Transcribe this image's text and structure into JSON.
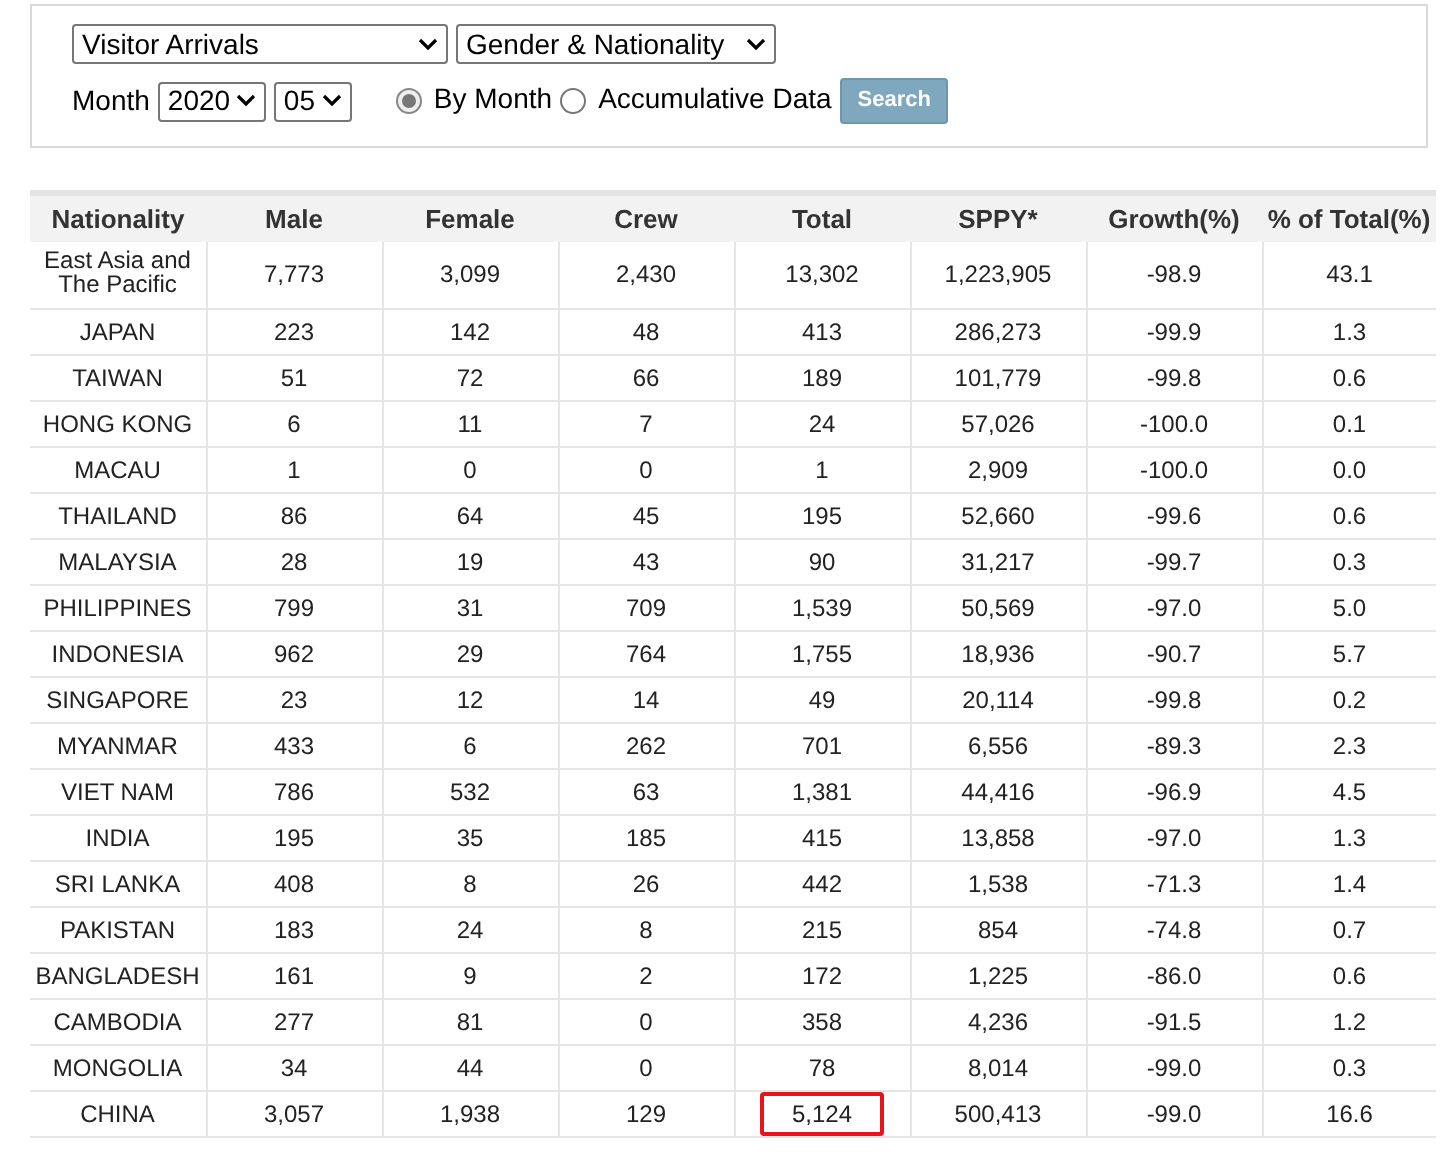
{
  "filters": {
    "dataset": "Visitor Arrivals",
    "breakdown": "Gender & Nationality",
    "month_label": "Month",
    "year": "2020",
    "month": "05",
    "options": [
      {
        "label": "By Month",
        "selected": true
      },
      {
        "label": "Accumulative Data",
        "selected": false
      }
    ],
    "search_button": "Search"
  },
  "table": {
    "columns": [
      "Nationality",
      "Male",
      "Female",
      "Crew",
      "Total",
      "SPPY*",
      "Growth(%)",
      "% of Total(%)"
    ],
    "rows": [
      {
        "cells": [
          "East Asia and The Pacific",
          "7,773",
          "3,099",
          "2,430",
          "13,302",
          "1,223,905",
          "-98.9",
          "43.1"
        ],
        "highlighted": false
      },
      {
        "cells": [
          "JAPAN",
          "223",
          "142",
          "48",
          "413",
          "286,273",
          "-99.9",
          "1.3"
        ],
        "highlighted": false
      },
      {
        "cells": [
          "TAIWAN",
          "51",
          "72",
          "66",
          "189",
          "101,779",
          "-99.8",
          "0.6"
        ],
        "highlighted": false
      },
      {
        "cells": [
          "HONG KONG",
          "6",
          "11",
          "7",
          "24",
          "57,026",
          "-100.0",
          "0.1"
        ],
        "highlighted": false
      },
      {
        "cells": [
          "MACAU",
          "1",
          "0",
          "0",
          "1",
          "2,909",
          "-100.0",
          "0.0"
        ],
        "highlighted": false
      },
      {
        "cells": [
          "THAILAND",
          "86",
          "64",
          "45",
          "195",
          "52,660",
          "-99.6",
          "0.6"
        ],
        "highlighted": false
      },
      {
        "cells": [
          "MALAYSIA",
          "28",
          "19",
          "43",
          "90",
          "31,217",
          "-99.7",
          "0.3"
        ],
        "highlighted": false
      },
      {
        "cells": [
          "PHILIPPINES",
          "799",
          "31",
          "709",
          "1,539",
          "50,569",
          "-97.0",
          "5.0"
        ],
        "highlighted": false
      },
      {
        "cells": [
          "INDONESIA",
          "962",
          "29",
          "764",
          "1,755",
          "18,936",
          "-90.7",
          "5.7"
        ],
        "highlighted": false
      },
      {
        "cells": [
          "SINGAPORE",
          "23",
          "12",
          "14",
          "49",
          "20,114",
          "-99.8",
          "0.2"
        ],
        "highlighted": false
      },
      {
        "cells": [
          "MYANMAR",
          "433",
          "6",
          "262",
          "701",
          "6,556",
          "-89.3",
          "2.3"
        ],
        "highlighted": false
      },
      {
        "cells": [
          "VIET NAM",
          "786",
          "532",
          "63",
          "1,381",
          "44,416",
          "-96.9",
          "4.5"
        ],
        "highlighted": false
      },
      {
        "cells": [
          "INDIA",
          "195",
          "35",
          "185",
          "415",
          "13,858",
          "-97.0",
          "1.3"
        ],
        "highlighted": false
      },
      {
        "cells": [
          "SRI LANKA",
          "408",
          "8",
          "26",
          "442",
          "1,538",
          "-71.3",
          "1.4"
        ],
        "highlighted": false
      },
      {
        "cells": [
          "PAKISTAN",
          "183",
          "24",
          "8",
          "215",
          "854",
          "-74.8",
          "0.7"
        ],
        "highlighted": false
      },
      {
        "cells": [
          "BANGLADESH",
          "161",
          "9",
          "2",
          "172",
          "1,225",
          "-86.0",
          "0.6"
        ],
        "highlighted": false
      },
      {
        "cells": [
          "CAMBODIA",
          "277",
          "81",
          "0",
          "358",
          "4,236",
          "-91.5",
          "1.2"
        ],
        "highlighted": false
      },
      {
        "cells": [
          "MONGOLIA",
          "34",
          "44",
          "0",
          "78",
          "8,014",
          "-99.0",
          "0.3"
        ],
        "highlighted": false
      },
      {
        "cells": [
          "CHINA",
          "3,057",
          "1,938",
          "129",
          "5,124",
          "500,413",
          "-99.0",
          "16.6"
        ],
        "highlighted": true
      }
    ]
  }
}
